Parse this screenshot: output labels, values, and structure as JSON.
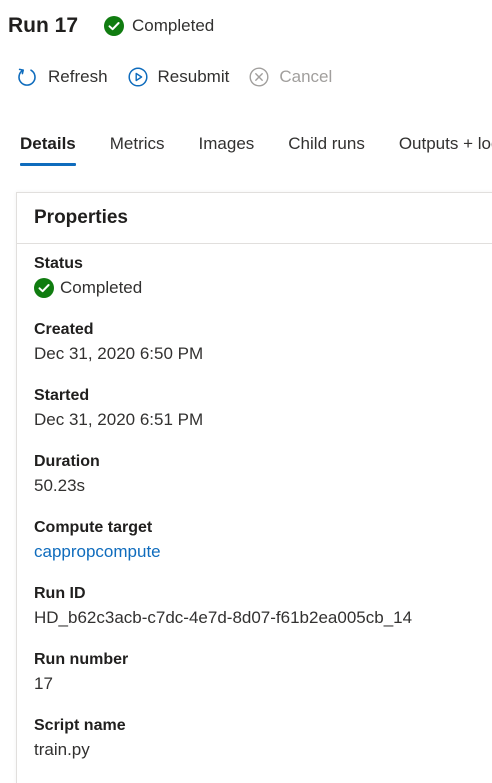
{
  "header": {
    "title": "Run 17",
    "status": "Completed"
  },
  "toolbar": {
    "refresh": "Refresh",
    "resubmit": "Resubmit",
    "cancel": "Cancel"
  },
  "tabs": [
    {
      "label": "Details",
      "active": true
    },
    {
      "label": "Metrics"
    },
    {
      "label": "Images"
    },
    {
      "label": "Child runs"
    },
    {
      "label": "Outputs + logs"
    }
  ],
  "properties": {
    "title": "Properties",
    "items": [
      {
        "label": "Status",
        "value": "Completed"
      },
      {
        "label": "Created",
        "value": "Dec 31, 2020 6:50 PM"
      },
      {
        "label": "Started",
        "value": "Dec 31, 2020 6:51 PM"
      },
      {
        "label": "Duration",
        "value": "50.23s"
      },
      {
        "label": "Compute target",
        "value": "cappropcompute"
      },
      {
        "label": "Run ID",
        "value": "HD_b62c3acb-c7dc-4e7d-8d07-f61b2ea005cb_14"
      },
      {
        "label": "Run number",
        "value": "17"
      },
      {
        "label": "Script name",
        "value": "train.py"
      }
    ]
  },
  "colors": {
    "success": "#107c10",
    "accent": "#0f6cbd",
    "disabled": "#a19f9d"
  }
}
